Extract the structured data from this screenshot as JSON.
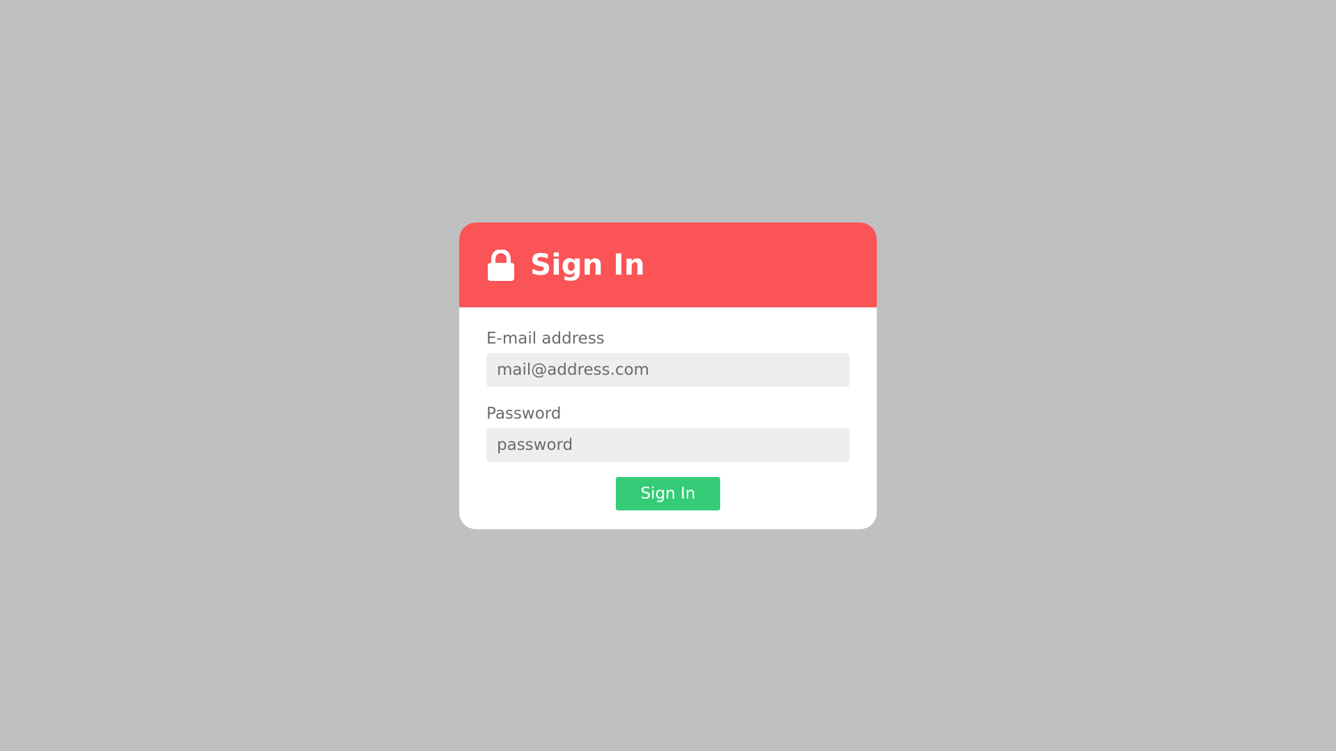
{
  "colors": {
    "page_background": "#c0c0c0",
    "header_background": "#fa5456",
    "card_background": "#ffffff",
    "input_background": "#eeeeee",
    "button_background": "#34cc77",
    "label_text": "#6b6b6b"
  },
  "header": {
    "icon": "lock-icon",
    "title": "Sign In"
  },
  "form": {
    "email": {
      "label": "E-mail address",
      "placeholder": "mail@address.com",
      "value": ""
    },
    "password": {
      "label": "Password",
      "placeholder": "password",
      "value": ""
    },
    "submit_label": "Sign In"
  }
}
